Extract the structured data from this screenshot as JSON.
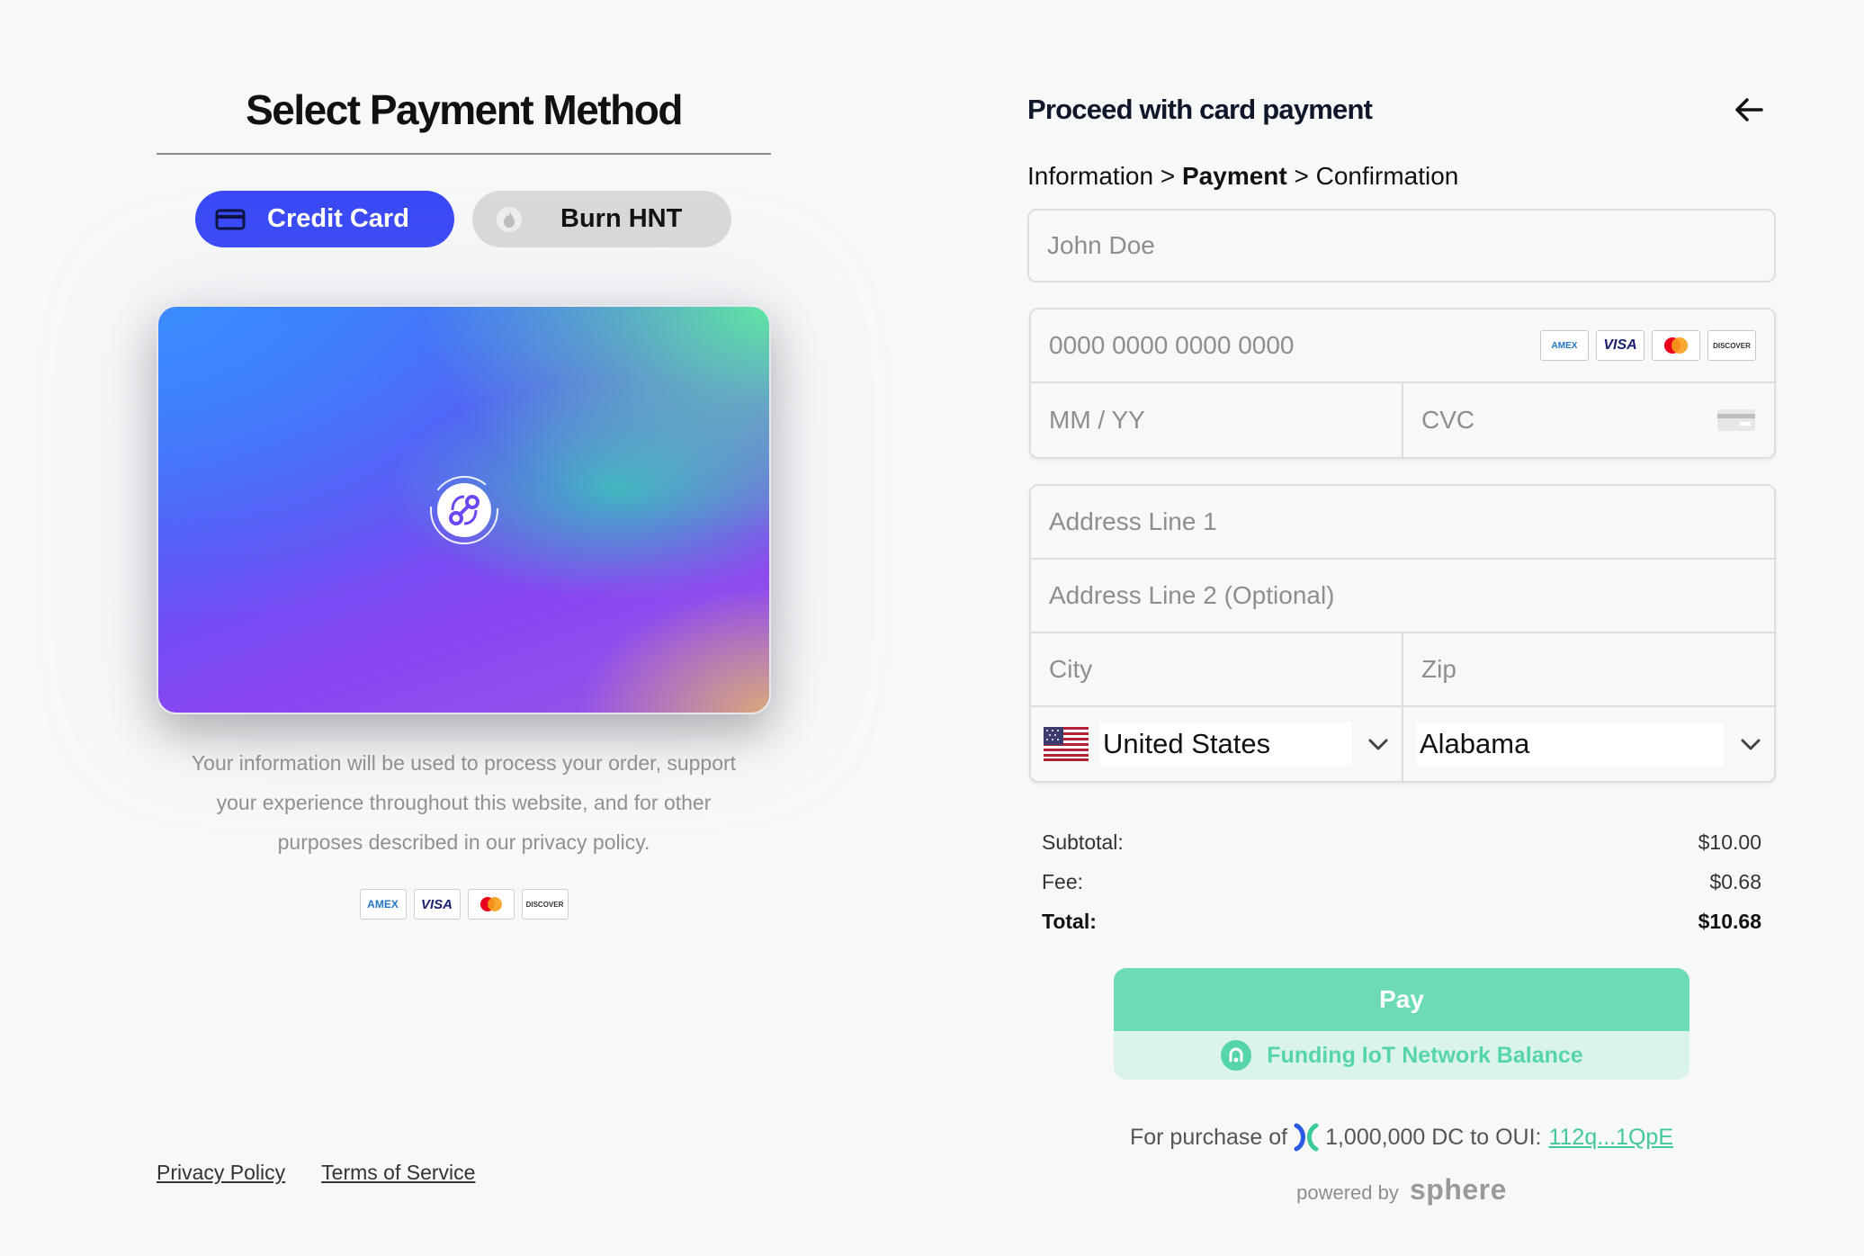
{
  "left": {
    "title": "Select Payment Method",
    "tabs": [
      {
        "label": "Credit Card",
        "icon": "credit-card-icon",
        "active": true
      },
      {
        "label": "Burn HNT",
        "icon": "burn-icon",
        "active": false
      }
    ],
    "privacy_text": "Your information will be used to process your order, support your experience throughout this website, and for other purposes described in our privacy policy.",
    "card_logos": [
      "AMEX",
      "VISA",
      "Mastercard",
      "DISCOVER"
    ],
    "accent": "#3949f5"
  },
  "footer": {
    "privacy_link": "Privacy Policy",
    "terms_link": "Terms of Service"
  },
  "right": {
    "title": "Proceed with card payment",
    "steps": {
      "step1": "Information",
      "sep": ">",
      "step2": "Payment",
      "step3": "Confirmation"
    },
    "fields": {
      "name_placeholder": "John Doe",
      "card_number_placeholder": "0000 0000 0000 0000",
      "expiry_placeholder": "MM / YY",
      "cvc_placeholder": "CVC",
      "address1_placeholder": "Address Line 1",
      "address2_placeholder": "Address Line 2 (Optional)",
      "city_placeholder": "City",
      "zip_placeholder": "Zip",
      "country_value": "United States",
      "state_value": "Alabama"
    },
    "card_brands": [
      "AMEX",
      "VISA",
      "Mastercard",
      "DISCOVER"
    ],
    "totals": {
      "subtotal_label": "Subtotal:",
      "subtotal_value": "$10.00",
      "fee_label": "Fee:",
      "fee_value": "$0.68",
      "total_label": "Total:",
      "total_value": "$10.68"
    },
    "pay_label": "Pay",
    "funding_label": "Funding IoT Network Balance",
    "purchase": {
      "prefix": "For purchase of",
      "amount": "1,000,000 DC to OUI:",
      "link": "112q...1QpE"
    },
    "powered": {
      "prefix": "powered by",
      "brand": "sphere"
    },
    "pay_color": "#6ddcb4"
  }
}
